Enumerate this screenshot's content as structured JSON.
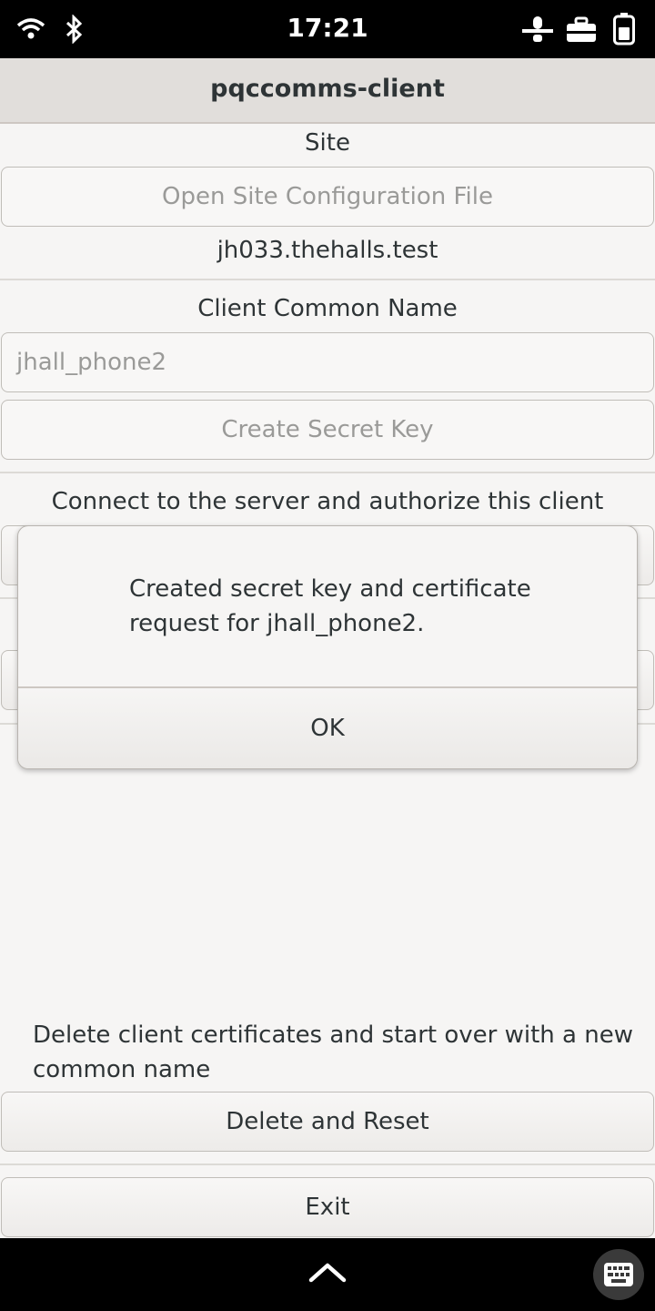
{
  "status": {
    "time": "17:21"
  },
  "app": {
    "title": "pqccomms-client"
  },
  "site": {
    "label": "Site",
    "open_button": "Open Site Configuration File",
    "value": "jh033.thehalls.test"
  },
  "client": {
    "label": "Client Common Name",
    "input_value": "jhall_phone2",
    "create_button": "Create Secret Key"
  },
  "connect": {
    "label": "Connect to the server and authorize this client"
  },
  "dialog": {
    "message_line1": "Created secret key and certificate",
    "message_line2": "request for jhall_phone2.",
    "ok_label": "OK"
  },
  "reset": {
    "description_line1": "Delete client certificates and start over with a new",
    "description_line2": "common name",
    "button": "Delete and Reset"
  },
  "exit": {
    "button": "Exit"
  }
}
